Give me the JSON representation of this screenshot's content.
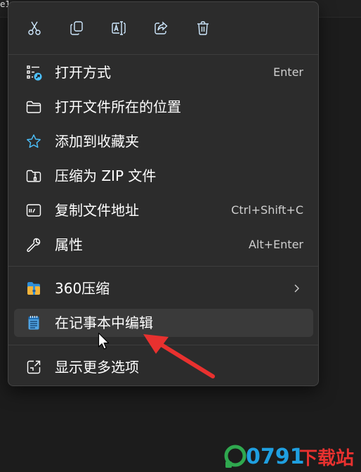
{
  "window": {
    "title_fragment": "e1"
  },
  "toolbar": {
    "cut_icon": "scissors-icon",
    "copy_icon": "copy-icon",
    "rename_icon": "rename-icon",
    "share_icon": "share-icon",
    "delete_icon": "trash-icon"
  },
  "menu": {
    "items": [
      {
        "label": "打开方式",
        "shortcut": "Enter",
        "icon": "open-with-icon"
      },
      {
        "label": "打开文件所在的位置",
        "shortcut": "",
        "icon": "folder-icon"
      },
      {
        "label": "添加到收藏夹",
        "shortcut": "",
        "icon": "star-icon"
      },
      {
        "label": "压缩为 ZIP 文件",
        "shortcut": "",
        "icon": "zip-folder-icon"
      },
      {
        "label": "复制文件地址",
        "shortcut": "Ctrl+Shift+C",
        "icon": "copy-path-icon"
      },
      {
        "label": "属性",
        "shortcut": "Alt+Enter",
        "icon": "wrench-icon"
      }
    ],
    "extra_items": [
      {
        "label": "360压缩",
        "icon": "360-archive-icon",
        "has_submenu": true
      },
      {
        "label": "在记事本中编辑",
        "icon": "notepad-icon",
        "hovered": true
      }
    ],
    "more_item": {
      "label": "显示更多选项",
      "icon": "more-options-icon"
    }
  },
  "watermark": {
    "text": "0791下载站",
    "number": "0791",
    "suffix": "下载站"
  },
  "colors": {
    "menu_bg": "#2c2c2c",
    "hover_bg": "#3a3a3a",
    "accent_blue": "#4cc2ff",
    "annotation_red": "#e8312f"
  }
}
